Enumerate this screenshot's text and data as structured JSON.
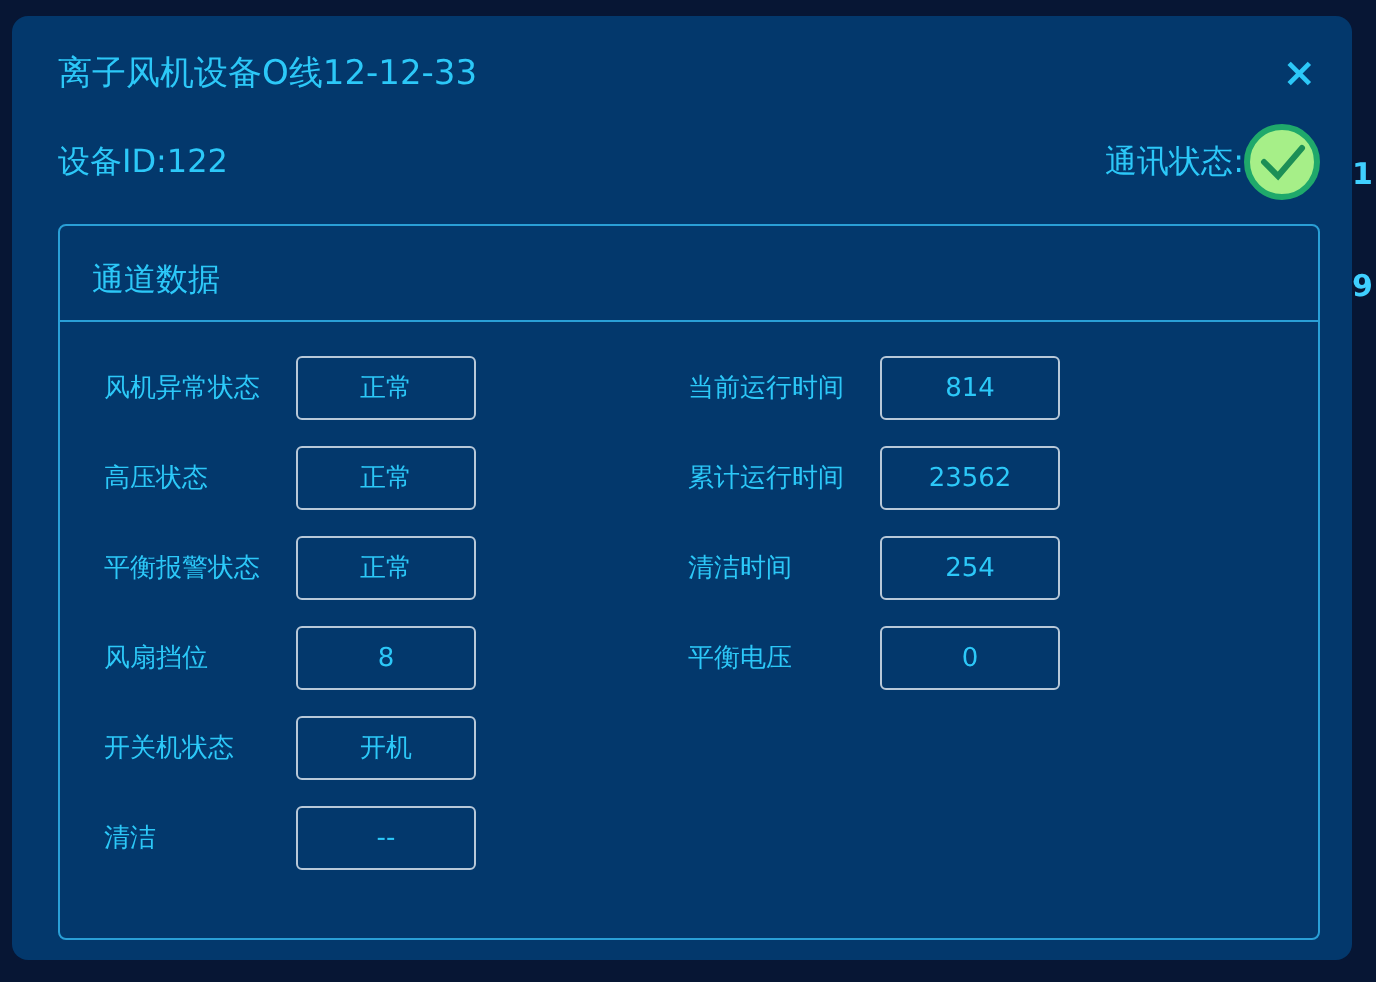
{
  "background": {
    "right_fragments": [
      "1",
      "9"
    ]
  },
  "dialog": {
    "title": "离子风机设备O线12-12-33",
    "close": "×",
    "device_id": "设备ID:122",
    "comm_status": {
      "label": "通讯状态:",
      "online": true
    }
  },
  "panel": {
    "title": "通道数据",
    "left_fields": [
      {
        "label": "风机异常状态",
        "value": "正常"
      },
      {
        "label": "高压状态",
        "value": "正常"
      },
      {
        "label": "平衡报警状态",
        "value": "正常"
      },
      {
        "label": "风扇挡位",
        "value": "8"
      },
      {
        "label": "开关机状态",
        "value": "开机"
      },
      {
        "label": "清洁",
        "value": "--"
      }
    ],
    "right_fields": [
      {
        "label": "当前运行时间",
        "value": "814"
      },
      {
        "label": "累计运行时间",
        "value": "23562"
      },
      {
        "label": "清洁时间",
        "value": "254"
      },
      {
        "label": "平衡电压",
        "value": "0"
      }
    ]
  }
}
